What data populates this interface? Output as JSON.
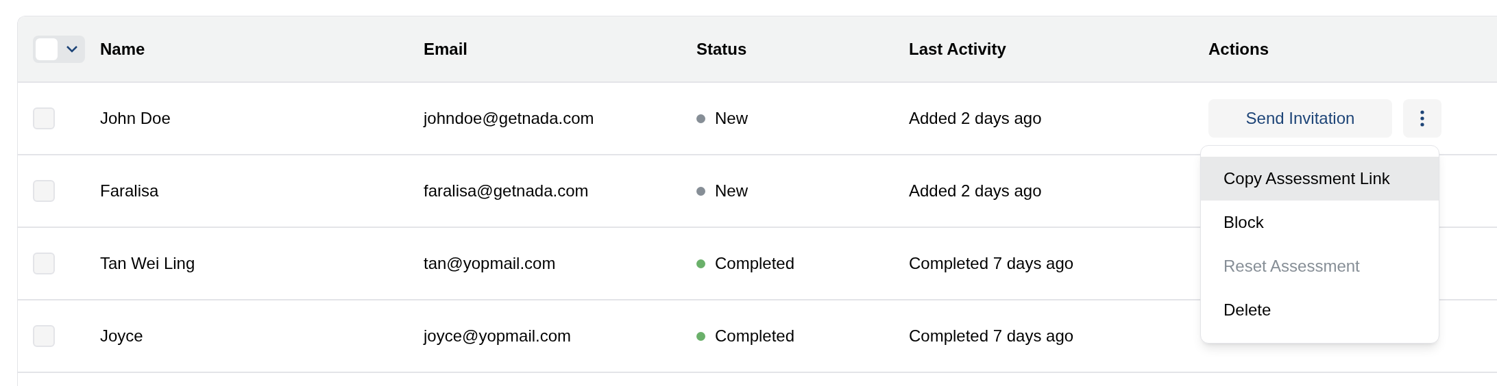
{
  "table": {
    "select_all": {
      "checked": false
    },
    "columns": [
      "Name",
      "Email",
      "Status",
      "Last Activity",
      "Actions"
    ],
    "rows": [
      {
        "checked": false,
        "name": "John Doe",
        "email": "johndoe@getnada.com",
        "status": "New",
        "color": "#868e96",
        "last_activity": "Added 2 days ago",
        "action": "Send Invitation"
      },
      {
        "checked": false,
        "name": "Faralisa",
        "email": "faralisa@getnada.com",
        "status": "New",
        "color": "#868e96",
        "last_activity": "Added 2 days ago"
      },
      {
        "checked": false,
        "name": "Tan Wei Ling",
        "email": "tan@yopmail.com",
        "status": "Completed",
        "color": "#6ab06a",
        "last_activity": "Completed 7 days ago"
      },
      {
        "checked": false,
        "name": "Joyce",
        "email": "joyce@yopmail.com",
        "status": "Completed",
        "color": "#6ab06a",
        "last_activity": "Completed 7 days ago"
      }
    ]
  },
  "menu": {
    "items": [
      {
        "label": "Copy Assessment Link",
        "selected": true,
        "disabled": false
      },
      {
        "label": "Block",
        "selected": false,
        "disabled": false
      },
      {
        "label": "Reset Assessment",
        "selected": false,
        "disabled": true
      },
      {
        "label": "Delete",
        "selected": false,
        "disabled": false
      }
    ]
  }
}
